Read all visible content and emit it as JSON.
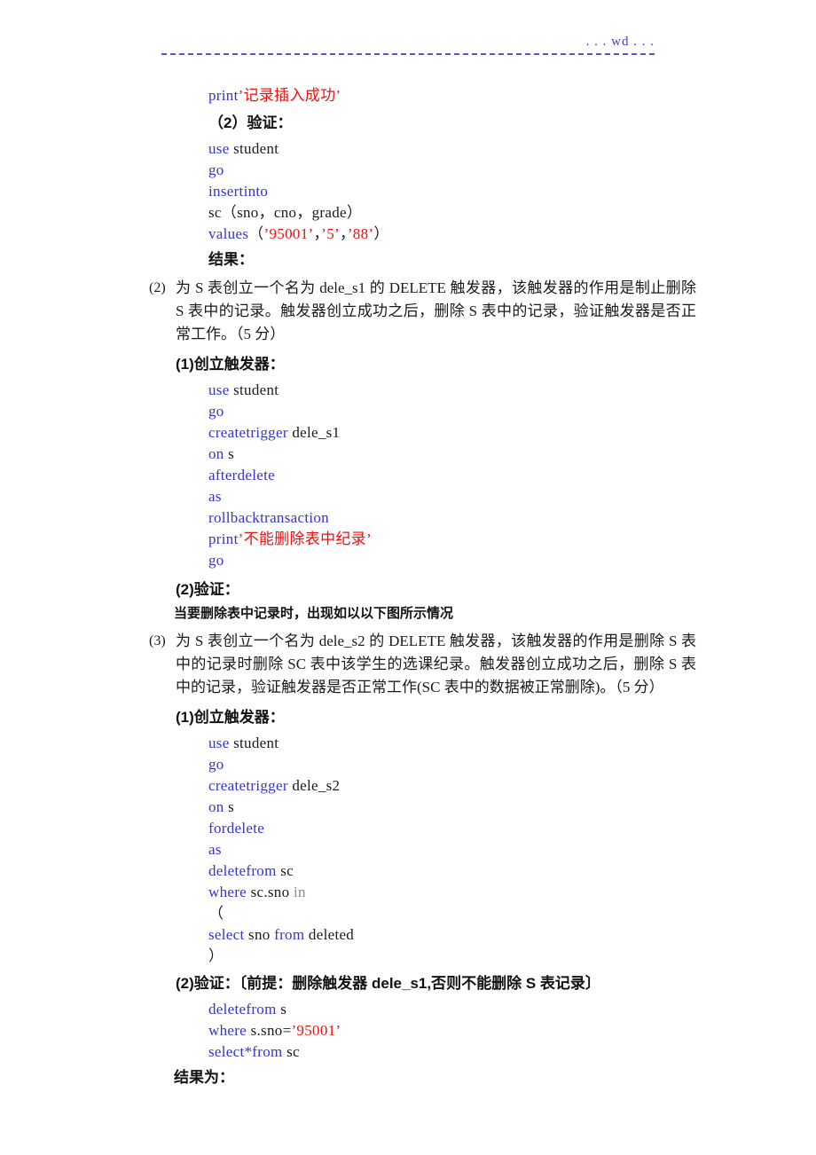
{
  "header": {
    "label": ". . . wd . . ."
  },
  "blocks": [
    {
      "id": "code-print-success",
      "lines": [
        {
          "segments": [
            {
              "t": "print",
              "c": "kw"
            },
            {
              "t": "’记录插入成功’",
              "c": "str"
            }
          ]
        }
      ]
    },
    {
      "id": "heading-verify-1",
      "text": "（2）验证："
    },
    {
      "id": "code-insert-sc",
      "lines": [
        {
          "segments": [
            {
              "t": "use",
              "c": "kw"
            },
            {
              "t": " student",
              "c": "plain"
            }
          ]
        },
        {
          "segments": [
            {
              "t": "go",
              "c": "kw"
            }
          ]
        },
        {
          "segments": [
            {
              "t": "insertinto",
              "c": "kw"
            }
          ]
        },
        {
          "segments": [
            {
              "t": "sc",
              "c": "plain"
            },
            {
              "t": "（sno，cno，grade）",
              "c": "plain"
            }
          ]
        },
        {
          "segments": [
            {
              "t": "values",
              "c": "kw"
            },
            {
              "t": "（",
              "c": "plain"
            },
            {
              "t": "’95001’",
              "c": "str"
            },
            {
              "t": "，",
              "c": "plain"
            },
            {
              "t": "’5’",
              "c": "str"
            },
            {
              "t": "，",
              "c": "plain"
            },
            {
              "t": "’88’",
              "c": "str"
            },
            {
              "t": "）",
              "c": "plain"
            }
          ]
        }
      ]
    },
    {
      "id": "heading-result-1",
      "text": "结果："
    },
    {
      "id": "question-2",
      "marker": "(2)",
      "text": "为 S 表创立一个名为 dele_s1 的 DELETE 触发器，该触发器的作用是制止删除 S 表中的记录。触发器创立成功之后，删除 S 表中的记录，验证触发器是否正常工作。（5 分）"
    },
    {
      "id": "heading-create-trigger-1",
      "text": "(1)创立触发器："
    },
    {
      "id": "code-create-dele-s1",
      "lines": [
        {
          "segments": [
            {
              "t": "use",
              "c": "kw"
            },
            {
              "t": " student",
              "c": "plain"
            }
          ]
        },
        {
          "segments": [
            {
              "t": "go",
              "c": "kw"
            }
          ]
        },
        {
          "segments": [
            {
              "t": "createtrigger",
              "c": "kw"
            },
            {
              "t": " dele_s1",
              "c": "plain"
            }
          ]
        },
        {
          "segments": [
            {
              "t": "on",
              "c": "kw"
            },
            {
              "t": " s",
              "c": "plain"
            }
          ]
        },
        {
          "segments": [
            {
              "t": "afterdelete",
              "c": "kw"
            }
          ]
        },
        {
          "segments": [
            {
              "t": "as",
              "c": "kw"
            }
          ]
        },
        {
          "segments": [
            {
              "t": "rollbacktransaction",
              "c": "kw"
            }
          ]
        },
        {
          "segments": [
            {
              "t": "print",
              "c": "kw"
            },
            {
              "t": "’不能删除表中纪录’",
              "c": "str"
            }
          ]
        },
        {
          "segments": [
            {
              "t": "go",
              "c": "kw"
            }
          ]
        }
      ]
    },
    {
      "id": "heading-verify-2",
      "text": "(2)验证："
    },
    {
      "id": "note-delete-record",
      "text": "当要删除表中记录时，出现如以以下图所示情况"
    },
    {
      "id": "question-3",
      "marker": "(3)",
      "text": "为 S 表创立一个名为 dele_s2 的 DELETE 触发器，该触发器的作用是删除 S 表中的记录时删除 SC 表中该学生的选课纪录。触发器创立成功之后，删除 S 表中的记录，验证触发器是否正常工作(SC 表中的数据被正常删除)。（5 分）"
    },
    {
      "id": "heading-create-trigger-2",
      "text": "(1)创立触发器："
    },
    {
      "id": "code-create-dele-s2",
      "lines": [
        {
          "segments": [
            {
              "t": "use",
              "c": "kw"
            },
            {
              "t": " student",
              "c": "plain"
            }
          ]
        },
        {
          "segments": [
            {
              "t": "go",
              "c": "kw"
            }
          ]
        },
        {
          "segments": [
            {
              "t": "createtrigger",
              "c": "kw"
            },
            {
              "t": " dele_s2",
              "c": "plain"
            }
          ]
        },
        {
          "segments": [
            {
              "t": "on",
              "c": "kw"
            },
            {
              "t": " s",
              "c": "plain"
            }
          ]
        },
        {
          "segments": [
            {
              "t": "fordelete",
              "c": "kw"
            }
          ]
        },
        {
          "segments": [
            {
              "t": "as",
              "c": "kw"
            }
          ]
        },
        {
          "segments": [
            {
              "t": "deletefrom",
              "c": "kw"
            },
            {
              "t": " sc",
              "c": "plain"
            }
          ]
        },
        {
          "segments": [
            {
              "t": "where",
              "c": "kw"
            },
            {
              "t": " sc.sno ",
              "c": "plain"
            },
            {
              "t": "in",
              "c": "dim"
            }
          ]
        },
        {
          "segments": [
            {
              "t": "（",
              "c": "plain"
            }
          ]
        },
        {
          "segments": [
            {
              "t": "select",
              "c": "kw"
            },
            {
              "t": " sno ",
              "c": "plain"
            },
            {
              "t": "from",
              "c": "kw"
            },
            {
              "t": " deleted",
              "c": "plain"
            }
          ]
        },
        {
          "segments": [
            {
              "t": "）",
              "c": "plain"
            }
          ]
        }
      ]
    },
    {
      "id": "heading-verify-3",
      "text": "(2)验证：〔前提：删除触发器 dele_s1,否则不能删除 S 表记录〕"
    },
    {
      "id": "code-delete-s",
      "lines": [
        {
          "segments": [
            {
              "t": "deletefrom",
              "c": "kw"
            },
            {
              "t": " s",
              "c": "plain"
            }
          ]
        },
        {
          "segments": [
            {
              "t": "where",
              "c": "kw"
            },
            {
              "t": " s.sno=",
              "c": "plain"
            },
            {
              "t": "’95001’",
              "c": "str"
            }
          ]
        },
        {
          "segments": [
            {
              "t": "select*from",
              "c": "kw"
            },
            {
              "t": " sc",
              "c": "plain"
            }
          ]
        }
      ]
    },
    {
      "id": "heading-result-2",
      "text": "结果为："
    }
  ],
  "colors": {
    "keyword": "#3434cf",
    "string": "#f01010",
    "plain": "#1a1a1a",
    "header": "#4040d0",
    "dim": "#8a8a8a"
  }
}
